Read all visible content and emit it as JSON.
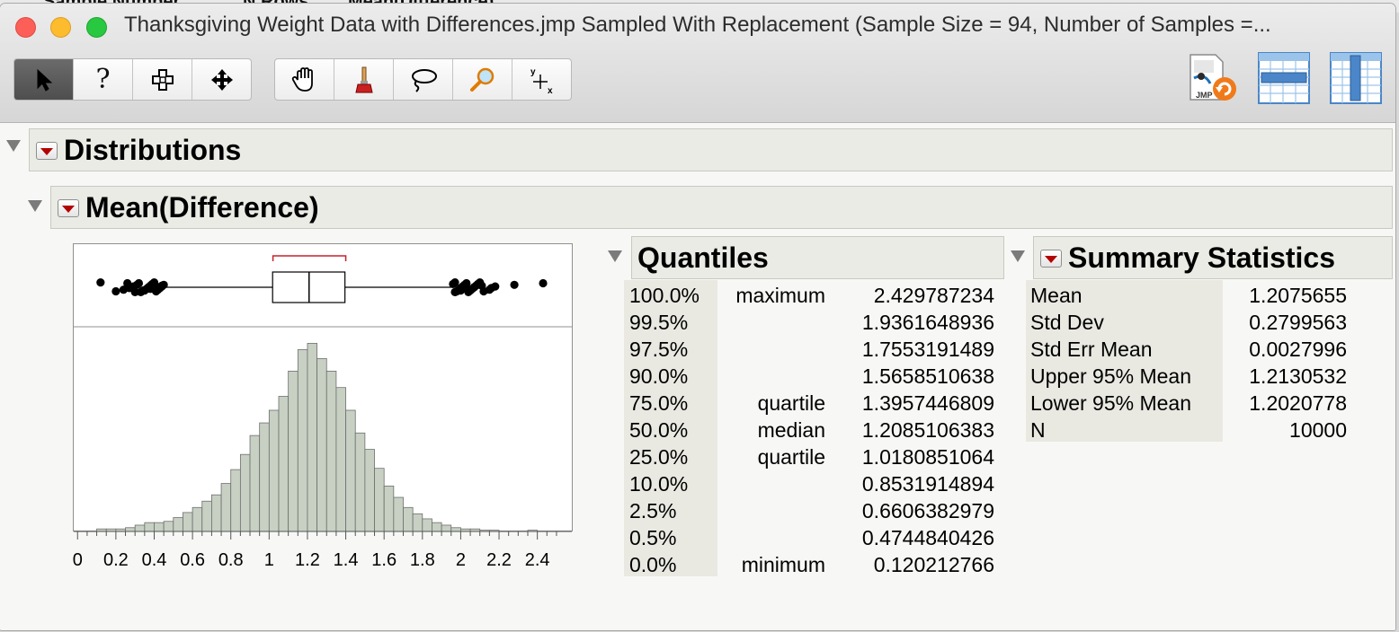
{
  "background_window": {
    "col1": "Sample Number",
    "col2": "N Rows",
    "col3": "Mean(Difference)"
  },
  "window": {
    "title": "Thanksgiving Weight Data with Differences.jmp Sampled With Replacement (Sample Size = 94, Number of Samples =..."
  },
  "toolbar": {
    "tools": [
      "arrow-tool",
      "help-tool",
      "selection-tool",
      "scroller-tool",
      "grabber-tool",
      "brush-tool",
      "lasso-tool",
      "magnifier-tool",
      "crosshair-tool"
    ],
    "help_label": "?",
    "crosshair_label_y": "y",
    "crosshair_label_x": "x",
    "jmp_icon_label": "JMP"
  },
  "report": {
    "distributions_title": "Distributions",
    "variable_title": "Mean(Difference)"
  },
  "histogram": {
    "type": "bar",
    "x_ticks": [
      "0",
      "0.2",
      "0.4",
      "0.6",
      "0.8",
      "1",
      "1.2",
      "1.4",
      "1.6",
      "1.8",
      "2",
      "2.2",
      "2.4"
    ],
    "xlim": [
      -0.02,
      2.58
    ],
    "bin_width": 0.05,
    "bin_starts": [
      0.1,
      0.15,
      0.2,
      0.25,
      0.3,
      0.35,
      0.4,
      0.45,
      0.5,
      0.55,
      0.6,
      0.65,
      0.7,
      0.75,
      0.8,
      0.85,
      0.9,
      0.95,
      1.0,
      1.05,
      1.1,
      1.15,
      1.2,
      1.25,
      1.3,
      1.35,
      1.4,
      1.45,
      1.5,
      1.55,
      1.6,
      1.65,
      1.7,
      1.75,
      1.8,
      1.85,
      1.9,
      1.95,
      2.0,
      2.05,
      2.1,
      2.15,
      2.2,
      2.25,
      2.3,
      2.35,
      2.4
    ],
    "counts": [
      2,
      2,
      2,
      3,
      5,
      7,
      7,
      8,
      11,
      15,
      19,
      24,
      29,
      38,
      49,
      61,
      76,
      86,
      96,
      107,
      127,
      144,
      149,
      137,
      127,
      114,
      96,
      78,
      65,
      50,
      36,
      27,
      19,
      14,
      10,
      7,
      5,
      3,
      2,
      2,
      1,
      1,
      0,
      0,
      0,
      1,
      0
    ],
    "ylim": [
      0,
      160
    ],
    "fill": "#c7d0c3",
    "stroke": "#6e6e6e"
  },
  "boxplot": {
    "q1": 1.0181,
    "median": 1.2085,
    "q3": 1.3957,
    "whisker_low": 0.455,
    "whisker_high": 1.955,
    "shortest_half": [
      1.02,
      1.4
    ],
    "outliers": [
      0.12,
      0.2,
      0.24,
      0.27,
      0.29,
      0.31,
      0.32,
      0.33,
      0.35,
      0.36,
      0.37,
      0.38,
      0.39,
      0.4,
      0.41,
      0.42,
      0.43,
      0.44,
      0.45,
      0.26,
      0.3,
      0.34,
      0.38,
      0.42,
      0.44,
      1.96,
      1.97,
      1.98,
      1.99,
      2.0,
      2.01,
      2.02,
      2.03,
      2.04,
      2.05,
      2.06,
      2.07,
      2.08,
      2.09,
      2.1,
      2.12,
      2.15,
      2.16,
      2.18,
      2.28,
      2.43,
      1.97,
      2.0,
      2.03,
      2.07,
      2.11
    ]
  },
  "quantiles": {
    "title": "Quantiles",
    "rows": [
      {
        "pct": "100.0%",
        "label": "maximum",
        "value": "2.429787234"
      },
      {
        "pct": "99.5%",
        "label": "",
        "value": "1.9361648936"
      },
      {
        "pct": "97.5%",
        "label": "",
        "value": "1.7553191489"
      },
      {
        "pct": "90.0%",
        "label": "",
        "value": "1.5658510638"
      },
      {
        "pct": "75.0%",
        "label": "quartile",
        "value": "1.3957446809"
      },
      {
        "pct": "50.0%",
        "label": "median",
        "value": "1.2085106383"
      },
      {
        "pct": "25.0%",
        "label": "quartile",
        "value": "1.0180851064"
      },
      {
        "pct": "10.0%",
        "label": "",
        "value": "0.8531914894"
      },
      {
        "pct": "2.5%",
        "label": "",
        "value": "0.6606382979"
      },
      {
        "pct": "0.5%",
        "label": "",
        "value": "0.4744840426"
      },
      {
        "pct": "0.0%",
        "label": "minimum",
        "value": "0.120212766"
      }
    ]
  },
  "summary": {
    "title": "Summary Statistics",
    "rows": [
      {
        "label": "Mean",
        "value": "1.2075655"
      },
      {
        "label": "Std Dev",
        "value": "0.2799563"
      },
      {
        "label": "Std Err Mean",
        "value": "0.0027996"
      },
      {
        "label": "Upper 95% Mean",
        "value": "1.2130532"
      },
      {
        "label": "Lower 95% Mean",
        "value": "1.2020778"
      },
      {
        "label": "N",
        "value": "10000"
      }
    ]
  }
}
